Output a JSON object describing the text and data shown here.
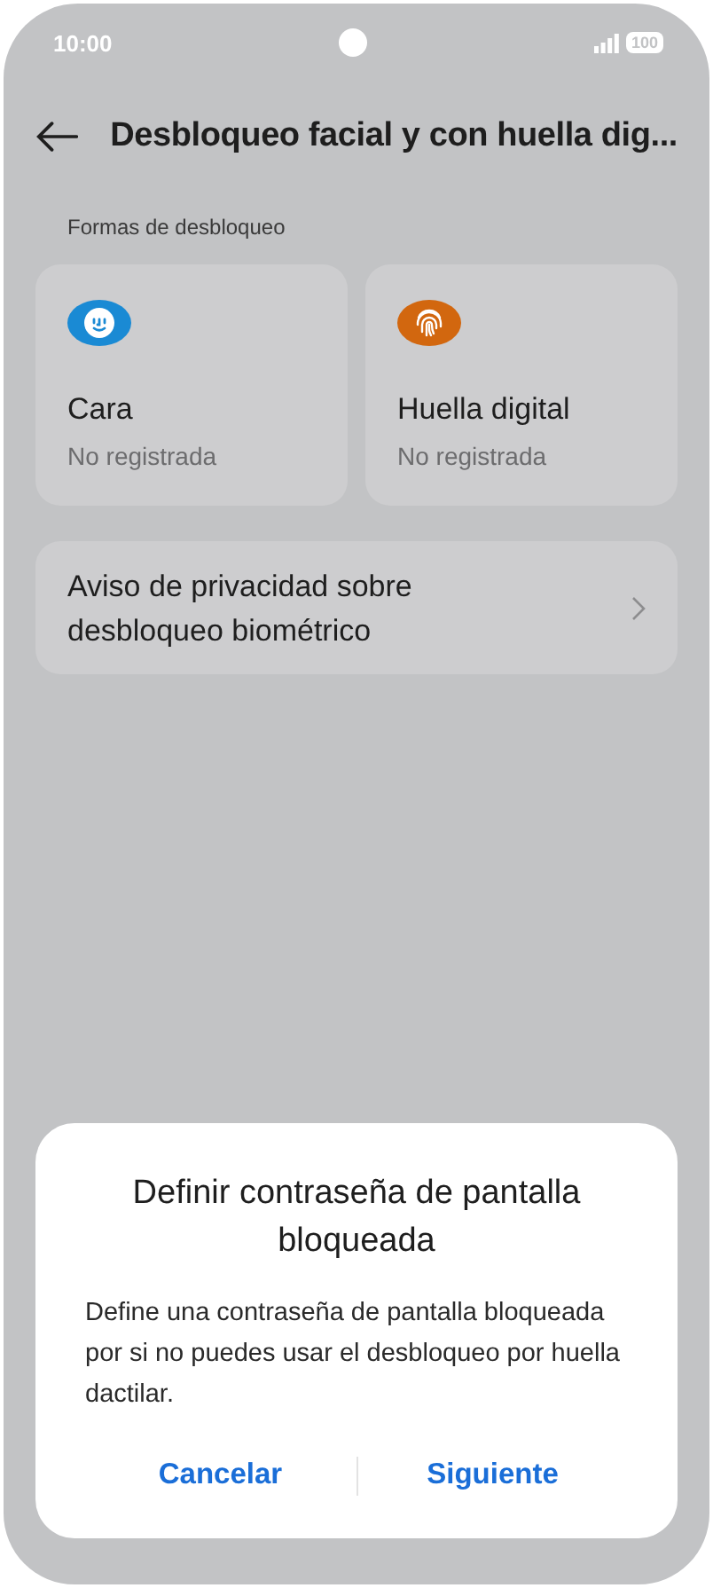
{
  "status_bar": {
    "time": "10:00",
    "battery": "100"
  },
  "header": {
    "title": "Desbloqueo facial y con huella dig..."
  },
  "section": {
    "label": "Formas de desbloqueo"
  },
  "methods": [
    {
      "kind": "face",
      "color": "#1a8ad4",
      "title": "Cara",
      "status": "No registrada"
    },
    {
      "kind": "fingerprint",
      "color": "#d2670f",
      "title": "Huella digital",
      "status": "No registrada"
    }
  ],
  "privacy_row": {
    "label": "Aviso de privacidad sobre desbloqueo biométrico"
  },
  "dialog": {
    "title": "Definir contraseña de pantalla bloqueada",
    "message": "Define una contraseña de pantalla bloqueada por si no puedes usar el desbloqueo por huella dactilar.",
    "buttons": [
      "Cancelar",
      "Siguiente"
    ]
  }
}
